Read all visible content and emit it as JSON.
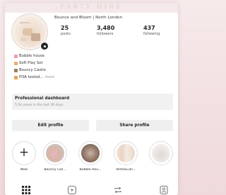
{
  "banner": {
    "text": "PARTY HIRE"
  },
  "profile": {
    "display_name": "Bounce and Bloom | North London",
    "avatar_caption": "sprout..."
  },
  "stats": {
    "posts": {
      "value": "25",
      "label": "posts"
    },
    "followers": {
      "value": "3,480",
      "label": "followers"
    },
    "following": {
      "value": "437",
      "label": "following"
    }
  },
  "bio": {
    "lines": [
      {
        "text": "Bubble house",
        "icon": "pink-house-icon",
        "color": "#ef9ab5"
      },
      {
        "text": "Soft Play Set",
        "icon": "blocks-icon",
        "color": "#e4b46a"
      },
      {
        "text": "Bouncy Castle",
        "icon": "castle-icon",
        "color": "#9e7b62"
      },
      {
        "text": "POA tested...",
        "icon": "check-icon",
        "color": "#e7a24a"
      }
    ],
    "more": "more"
  },
  "dashboard": {
    "title": "Professional dashboard",
    "subtitle": "5.2k views in the last 30 days."
  },
  "buttons": {
    "edit": "Edit profile",
    "share": "Share profile"
  },
  "highlights": [
    {
      "label": "New"
    },
    {
      "label": "Bouncy Cas..."
    },
    {
      "label": "Bubble Hou..."
    },
    {
      "label": "Tents&Can..."
    },
    {
      "label": ""
    }
  ],
  "tabs": [
    "grid-icon",
    "reels-icon",
    "reposts-icon",
    "tagged-icon"
  ],
  "colors": {
    "background_pink": "#f3e2e3",
    "button_grey": "#efefef",
    "text_dark": "#262626"
  }
}
